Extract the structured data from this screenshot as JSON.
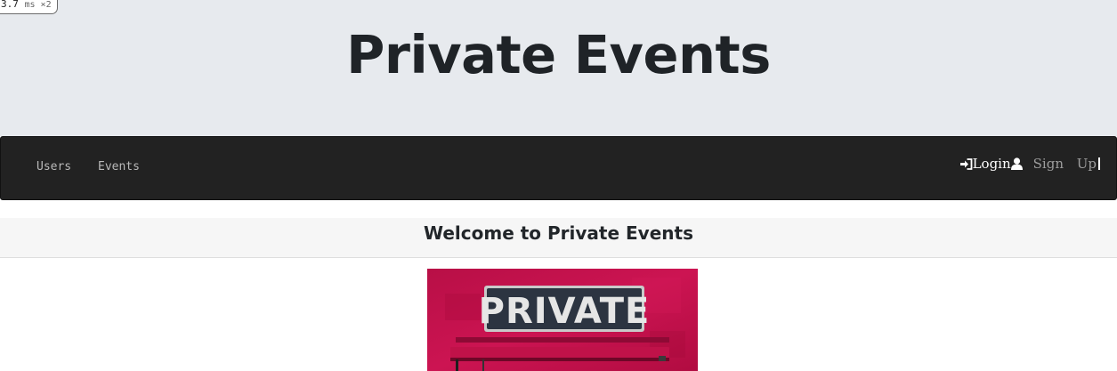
{
  "perf_badge": {
    "value": "3.7",
    "unit": "ms ×2"
  },
  "header": {
    "title": "Private Events"
  },
  "navbar": {
    "links": [
      {
        "label": "Users"
      },
      {
        "label": "Events"
      }
    ],
    "login_label": "Login",
    "signup_label": "Sign Up"
  },
  "main": {
    "welcome_title": "Welcome to Private Events",
    "image": {
      "sign_text": "PRIVATE"
    }
  },
  "colors": {
    "hero_bg": "#e7eaee",
    "navbar_bg": "#222222",
    "sign_red": "#c4104a",
    "sign_plate": "#2a3340"
  }
}
